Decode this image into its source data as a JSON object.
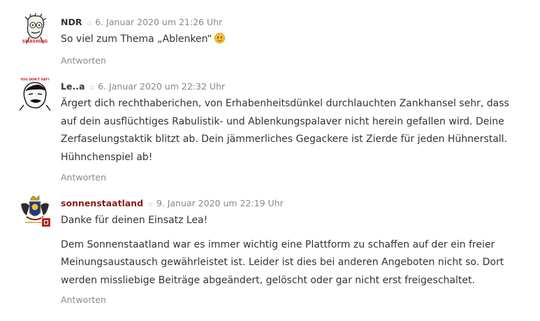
{
  "comments": [
    {
      "author": "NDR",
      "date": "6. Januar 2020 um 21:26 Uhr",
      "paragraphs": [
        "So viel zum Thema „Ablenken“"
      ],
      "emoji": "smiley-icon",
      "reply_label": "Antworten",
      "avatar_caption": "SMASHING"
    },
    {
      "author": "Le..a",
      "date": "6. Januar 2020 um 22:32 Uhr",
      "paragraphs": [
        "Ärgert dich rechthaberichen, von Erhabenheitsdünkel durchlauchten Zankhansel sehr, dass auf dein ausflüchtiges Rabulistik- und Ablenkungspalaver nicht herein gefallen wird. Deine Zerfaselungstaktik blitzt ab. Dein jämmerliches Gegackere ist Zierde für jeden Hühnerstall. Hühnchenspiel ab!"
      ],
      "reply_label": "Antworten",
      "avatar_caption": "YOU DON'T SAY?"
    },
    {
      "author": "sonnenstaatland",
      "date": "9. Januar 2020 um 22:19 Uhr",
      "paragraphs": [
        "Danke für deinen Einsatz Lea!",
        "Dem Sonnenstaatland war es immer wichtig eine Plattform zu schaffen auf der ein freier Meinungsaustausch gewährleistet ist. Leider ist dies bei anderen Angeboten nicht so. Dort werden missliebige Beiträge abgeändert, gelöscht oder gar nicht erst freigeschaltet."
      ],
      "reply_label": "Antworten"
    }
  ],
  "icons": {
    "separator": "square-icon",
    "admin_badge": "admin-badge-icon"
  },
  "colors": {
    "admin_author": "#8b1a1a",
    "meta_text": "#888888",
    "badge": "#b3261e"
  }
}
